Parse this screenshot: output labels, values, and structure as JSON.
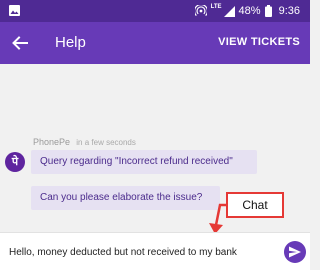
{
  "status_bar": {
    "network_label": "LTE",
    "battery": "48%",
    "time": "9:36",
    "icons": [
      "image-icon",
      "hotspot-icon",
      "signal-icon",
      "battery-icon"
    ]
  },
  "header": {
    "title": "Help",
    "action_label": "VIEW TICKETS",
    "back_icon": "arrow-left-icon"
  },
  "chat": {
    "sender": "PhonePe",
    "timestamp": "in a few seconds",
    "avatar_glyph": "पे",
    "messages": [
      {
        "text": "Query regarding \"Incorrect refund received\""
      },
      {
        "text": "Can you please elaborate the issue?"
      }
    ]
  },
  "annotation": {
    "label": "Chat",
    "color": "#e53935"
  },
  "composer": {
    "value": "Hello, money deducted but not received to my bank",
    "send_icon": "send-icon"
  },
  "colors": {
    "primary": "#673ab7",
    "status_bar": "#4f2a94",
    "bubble_bg": "#e6e1f2",
    "bubble_text": "#4b2b8c"
  }
}
